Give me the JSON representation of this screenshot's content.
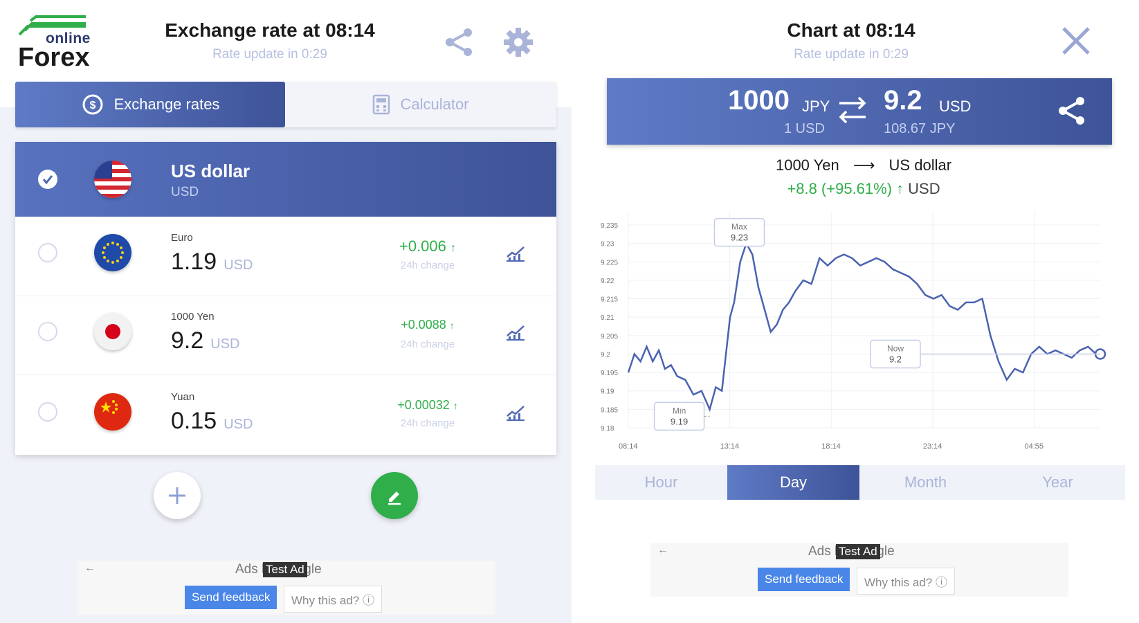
{
  "left": {
    "logo": {
      "small": "online",
      "big": "Forex"
    },
    "title": "Exchange rate at 08:14",
    "subtitle": "Rate update in 0:29",
    "tabs": [
      {
        "label": "Exchange rates",
        "icon": "exchange-icon",
        "active": true
      },
      {
        "label": "Calculator",
        "icon": "calculator-icon",
        "active": false
      }
    ],
    "base": {
      "name": "US dollar",
      "code": "USD"
    },
    "rates": [
      {
        "name": "Euro",
        "value": "1.19",
        "unit": "USD",
        "change": "+0.006",
        "change_label": "24h change"
      },
      {
        "name": "1000 Yen",
        "value": "9.2",
        "unit": "USD",
        "change": "+0.0088",
        "change_label": "24h change"
      },
      {
        "name": "Yuan",
        "value": "0.15",
        "unit": "USD",
        "change": "+0.00032",
        "change_label": "24h change"
      }
    ],
    "ad": {
      "ads_by": "Ads by Google",
      "tag": "Test Ad",
      "feedback": "Send feedback",
      "why": "Why this ad? ⓘ"
    }
  },
  "right": {
    "title": "Chart at 08:14",
    "subtitle": "Rate update in 0:29",
    "conversion": {
      "from_amount": "1000",
      "from_unit": "JPY",
      "from_sub": "1 USD",
      "to_amount": "9.2",
      "to_unit": "USD",
      "to_sub": "108.67 JPY"
    },
    "pair_from": "1000 Yen",
    "pair_to": "US dollar",
    "delta": "+8.8 (+95.61%) ↑",
    "delta_unit": "USD",
    "periods": [
      "Hour",
      "Day",
      "Month",
      "Year"
    ],
    "active_period": "Day",
    "ad": {
      "ads_by": "Ads by Google",
      "tag": "Test Ad",
      "feedback": "Send feedback",
      "why": "Why this ad? ⓘ"
    }
  },
  "chart_data": {
    "type": "line",
    "xlabel": "",
    "ylabel": "",
    "ylim": [
      9.18,
      9.235
    ],
    "y_ticks": [
      "9.18",
      "9.185",
      "9.19",
      "9.195",
      "9.2",
      "9.205",
      "9.21",
      "9.215",
      "9.22",
      "9.225",
      "9.23",
      "9.235"
    ],
    "x_ticks": [
      "08:14",
      "13:14",
      "18:14",
      "23:14",
      "04:55"
    ],
    "x": [
      0,
      0.3,
      0.6,
      0.9,
      1.2,
      1.5,
      1.8,
      2.1,
      2.4,
      2.8,
      3.2,
      3.6,
      4.0,
      4.3,
      4.6,
      4.8,
      5.0,
      5.2,
      5.5,
      5.8,
      6.1,
      6.4,
      6.7,
      7.0,
      7.3,
      7.6,
      7.9,
      8.2,
      8.6,
      9.0,
      9.4,
      9.8,
      10.2,
      10.6,
      11.0,
      11.4,
      11.8,
      12.2,
      12.6,
      13.0,
      13.4,
      13.8,
      14.2,
      14.6,
      15.0,
      15.4,
      15.8,
      16.2,
      16.6,
      17.0,
      17.4,
      17.8,
      18.2,
      18.6,
      19.0,
      19.4,
      19.8,
      20.2,
      20.6,
      21.0,
      21.4,
      21.8,
      22.2,
      22.6,
      23.0,
      23.2
    ],
    "y": [
      9.195,
      9.2,
      9.198,
      9.202,
      9.198,
      9.201,
      9.196,
      9.197,
      9.194,
      9.193,
      9.189,
      9.19,
      9.185,
      9.191,
      9.19,
      9.2,
      9.21,
      9.214,
      9.225,
      9.23,
      9.227,
      9.218,
      9.212,
      9.206,
      9.208,
      9.212,
      9.214,
      9.217,
      9.22,
      9.219,
      9.226,
      9.224,
      9.226,
      9.227,
      9.226,
      9.224,
      9.225,
      9.226,
      9.225,
      9.223,
      9.222,
      9.221,
      9.219,
      9.216,
      9.215,
      9.216,
      9.213,
      9.212,
      9.214,
      9.214,
      9.215,
      9.205,
      9.198,
      9.193,
      9.196,
      9.195,
      9.2,
      9.202,
      9.2,
      9.201,
      9.2,
      9.199,
      9.201,
      9.202,
      9.2,
      9.2
    ],
    "annotations": [
      {
        "label": "Max",
        "value": "9.23"
      },
      {
        "label": "Min",
        "value": "9.19"
      },
      {
        "label": "Now",
        "value": "9.2"
      }
    ]
  }
}
